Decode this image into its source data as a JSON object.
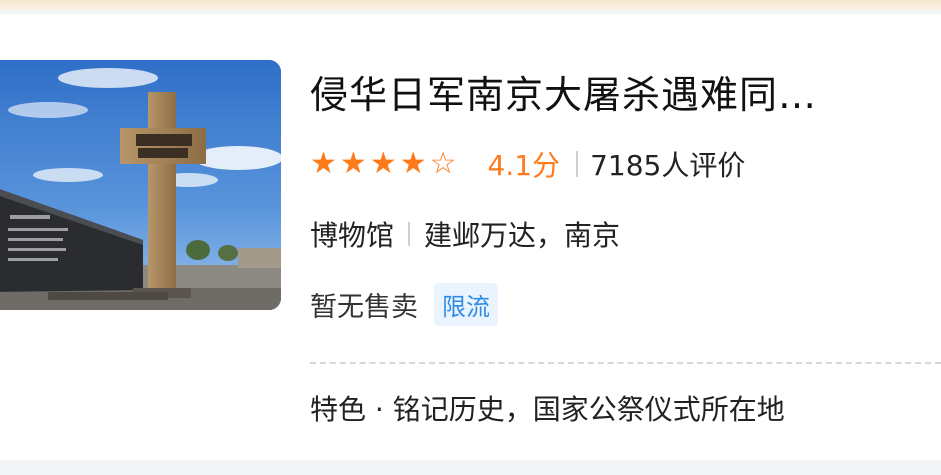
{
  "poi": {
    "image_alt": "photo-of-memorial-cross",
    "image_inscription": "1937.12.13 - 1938.1",
    "title": "侵华日军南京大屠杀遇难同…",
    "rating": {
      "stars_filled": 4,
      "stars_total": 5,
      "score_text": "4.1分",
      "reviews_text": "7185人评价"
    },
    "category": "博物馆",
    "location": "建邺万达，南京",
    "sale_status": "暂无售卖",
    "tag": "限流",
    "feature": "特色 · 铭记历史，国家公祭仪式所在地"
  },
  "colors": {
    "accent_orange": "#ff7a1a",
    "tag_blue": "#2f8be6",
    "tag_bg": "#eaf4ff"
  }
}
